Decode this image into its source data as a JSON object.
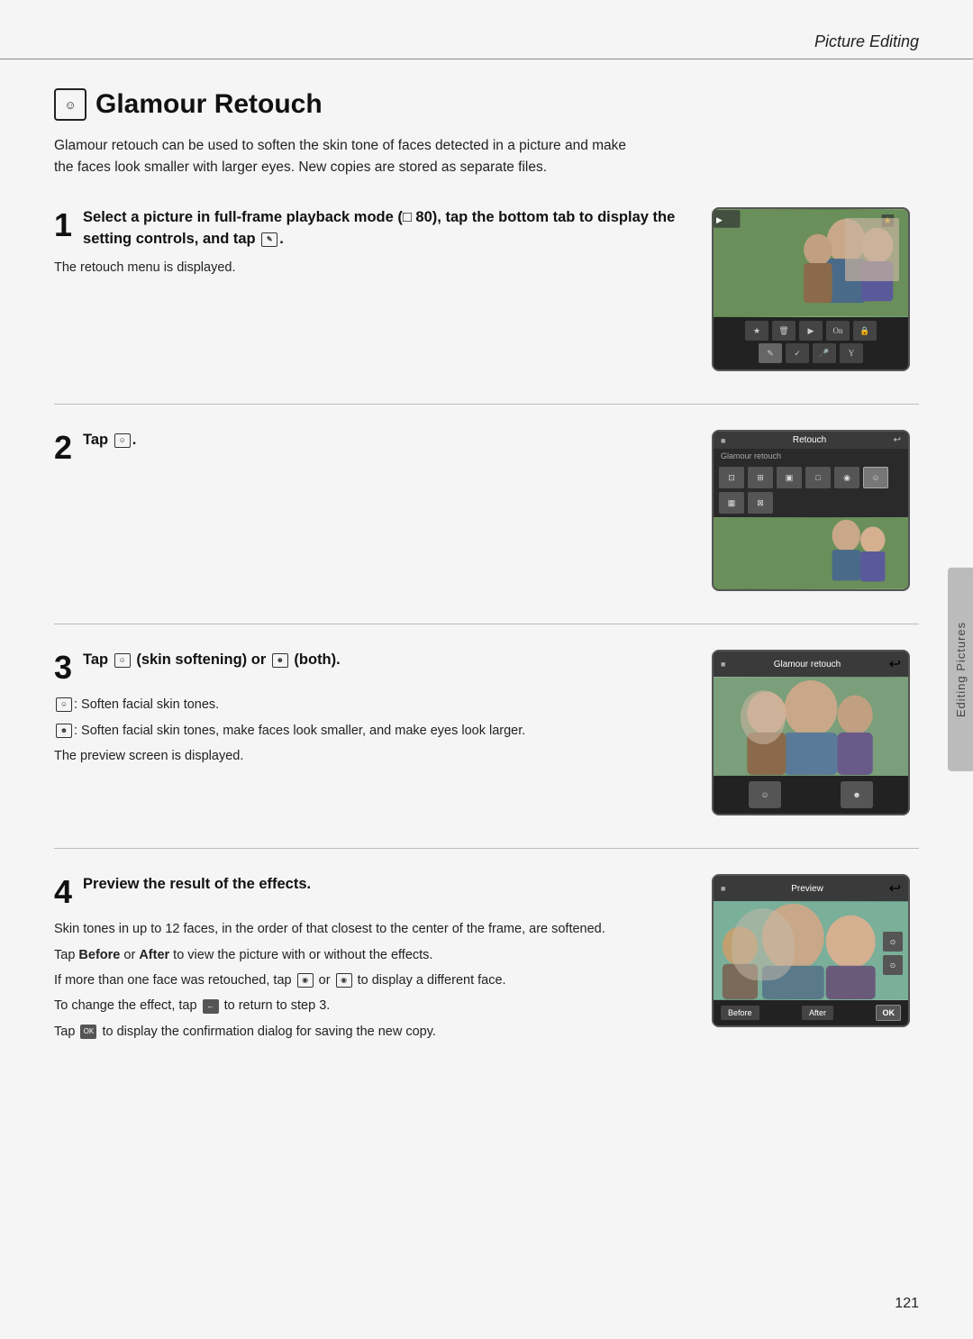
{
  "page": {
    "title": "Picture Editing",
    "page_number": "121",
    "side_tab": "Editing Pictures"
  },
  "section": {
    "icon_label": "☺",
    "heading": "Glamour Retouch",
    "intro": "Glamour retouch can be used to soften the skin tone of faces detected in a picture and make the faces look smaller with larger eyes. New copies are stored as separate files."
  },
  "steps": [
    {
      "number": "1",
      "heading": "Select a picture in full-frame playback mode (□ 80), tap the bottom tab to display the setting controls, and tap ✎.",
      "body": "The retouch menu is displayed."
    },
    {
      "number": "2",
      "heading": "Tap ☺.",
      "body": ""
    },
    {
      "number": "3",
      "heading": "Tap ☺ (skin softening) or ☻ (both).",
      "sub1_icon": "☺",
      "sub1_text": ": Soften facial skin tones.",
      "sub2_icon": "☻",
      "sub2_text": ": Soften facial skin tones, make faces look smaller, and make eyes look larger.",
      "sub3": "The preview screen is displayed."
    },
    {
      "number": "4",
      "heading": "Preview the result of the effects.",
      "body1": "Skin tones in up to 12 faces, in the order of that closest to the center of the frame, are softened.",
      "body2_prefix": "Tap ",
      "body2_bold1": "Before",
      "body2_mid": " or ",
      "body2_bold2": "After",
      "body2_suffix": " to view the picture with or without the effects.",
      "body3_prefix": "If more than one face was retouched, tap ",
      "body3_icon1": "⊙",
      "body3_mid": " or ",
      "body3_icon2": "⊙",
      "body3_suffix": " to display a different face.",
      "body4_prefix": "To change the effect, tap ",
      "body4_icon": "←",
      "body4_suffix": " to return to step 3.",
      "body5_prefix": "Tap ",
      "body5_icon": "OK",
      "body5_suffix": " to display the confirmation dialog for saving the new copy."
    }
  ],
  "device_labels": {
    "retouch": "Retouch",
    "glamour_retouch": "Glamour retouch",
    "preview": "Preview",
    "before": "Before",
    "after": "After",
    "ok": "OK"
  }
}
